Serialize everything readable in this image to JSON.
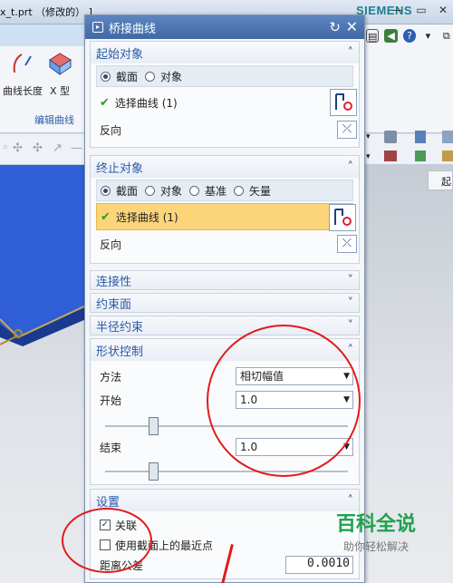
{
  "window": {
    "title": "x_t.prt （修改的） ]",
    "brand": "SIEMENS"
  },
  "ribbon": {
    "item1_label": "曲线长度",
    "item2_label": "X 型",
    "group_label": "编辑曲线",
    "right_tab": "起"
  },
  "dialog": {
    "title": "桥接曲线",
    "start_group": {
      "title": "起始对象",
      "options": [
        "截面",
        "对象"
      ],
      "selected": "截面",
      "select_label": "选择曲线 (1)",
      "reverse_label": "反向"
    },
    "end_group": {
      "title": "终止对象",
      "options": [
        "截面",
        "对象",
        "基准",
        "矢量"
      ],
      "selected": "截面",
      "select_label": "选择曲线 (1)",
      "reverse_label": "反向"
    },
    "collapsed": [
      "连接性",
      "约束面",
      "半径约束"
    ],
    "shape_control": {
      "title": "形状控制",
      "method_label": "方法",
      "method_value": "相切幅值",
      "start_label": "开始",
      "start_value": "1.0",
      "end_label": "结束",
      "end_value": "1.0"
    },
    "settings": {
      "title": "设置",
      "associative_label": "关联",
      "associative_checked": true,
      "nearest_point_label": "使用截面上的最近点",
      "nearest_point_checked": false,
      "tolerance_label": "距离公差",
      "tolerance_value": "0.0010"
    }
  },
  "watermark": {
    "main": "百科全说",
    "sub": "助你轻松解决"
  },
  "colors": {
    "accent": "#2b5aa8",
    "highlight": "#fcd57b",
    "annotation": "#e31b1b",
    "brand": "#1a7f8e"
  }
}
